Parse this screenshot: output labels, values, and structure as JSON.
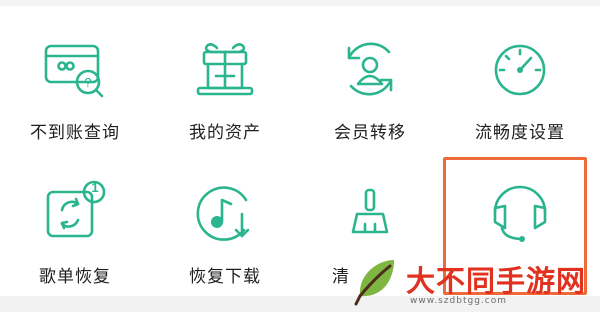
{
  "menu": {
    "items": [
      {
        "label": "不到账查询",
        "icon": "card-search-icon"
      },
      {
        "label": "我的资产",
        "icon": "gift-box-icon"
      },
      {
        "label": "会员转移",
        "icon": "user-transfer-icon"
      },
      {
        "label": "流畅度设置",
        "icon": "speedometer-icon"
      },
      {
        "label": "歌单恢复",
        "icon": "playlist-restore-icon",
        "badge": "1"
      },
      {
        "label": "恢复下载",
        "icon": "music-download-icon"
      },
      {
        "label": "清",
        "icon": "brush-icon"
      },
      {
        "label": "",
        "icon": "headset-icon"
      }
    ]
  },
  "watermark": {
    "title": "大不同手游网",
    "url": "www.szdbtgg.com"
  },
  "colors": {
    "icon": "#2bb58e",
    "highlight": "#ef6a3b",
    "watermark_title": "#e0321f"
  }
}
